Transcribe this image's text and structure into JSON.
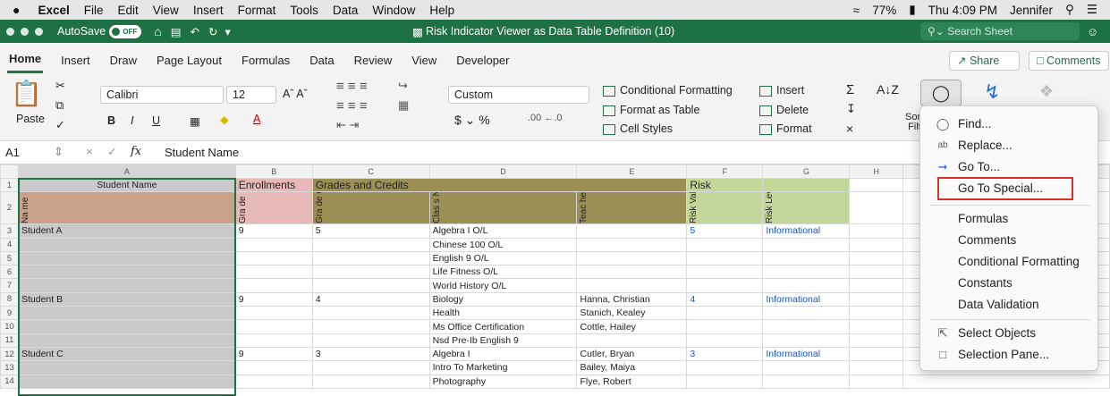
{
  "macbar": {
    "apple": "",
    "app": "Excel",
    "menus": [
      "File",
      "Edit",
      "View",
      "Insert",
      "Format",
      "Tools",
      "Data",
      "Window",
      "Help"
    ],
    "battery": "77%",
    "clock": "Thu 4:09 PM",
    "user": "Jennifer"
  },
  "titlebar": {
    "autosave": "AutoSave",
    "toggle": "OFF",
    "title": "Risk Indicator Viewer as Data Table Definition (10)",
    "search": "Search Sheet"
  },
  "tabs": [
    "Home",
    "Insert",
    "Draw",
    "Page Layout",
    "Formulas",
    "Data",
    "Review",
    "View",
    "Developer"
  ],
  "tab_buttons": {
    "share": "Share",
    "comments": "Comments"
  },
  "ribbon": {
    "paste": "Paste",
    "font": "Calibri",
    "size": "12",
    "number_format": "Custom",
    "cond_format": "Conditional Formatting",
    "format_table": "Format as Table",
    "cell_styles": "Cell Styles",
    "insert": "Insert",
    "delete": "Delete",
    "format": "Format",
    "sort": "Sort &",
    "filter": "Filter",
    "fx": "fx"
  },
  "formula_bar": {
    "cell": "A1",
    "content": "Student Name"
  },
  "columns": [
    "A",
    "B",
    "C",
    "D",
    "E",
    "F",
    "G",
    "H"
  ],
  "rows": [
    {
      "n": "1",
      "a": "Student Name",
      "b": "Enrollments",
      "c": "Grades and Credits",
      "d": "",
      "e": "",
      "f": "Risk",
      "g": ""
    },
    {
      "n": "2",
      "a": "Na me",
      "b": "Gra de",
      "c": "Gra de Cou nt",
      "d": "Clas s Na me",
      "e": "Teac her Na me",
      "f": "Risk Valu e",
      "g": "Risk Lev el"
    },
    {
      "n": "3",
      "a": "Student A",
      "b": "9",
      "c": "5",
      "d": "Algebra I O/L",
      "e": "",
      "f": "5",
      "g": "Informational"
    },
    {
      "n": "4",
      "a": "",
      "b": "",
      "c": "",
      "d": "Chinese 100 O/L",
      "e": "",
      "f": "",
      "g": ""
    },
    {
      "n": "5",
      "a": "",
      "b": "",
      "c": "",
      "d": "English 9 O/L",
      "e": "",
      "f": "",
      "g": ""
    },
    {
      "n": "6",
      "a": "",
      "b": "",
      "c": "",
      "d": "Life Fitness O/L",
      "e": "",
      "f": "",
      "g": ""
    },
    {
      "n": "7",
      "a": "",
      "b": "",
      "c": "",
      "d": "World History O/L",
      "e": "",
      "f": "",
      "g": ""
    },
    {
      "n": "8",
      "a": "Student B",
      "b": "9",
      "c": "4",
      "d": "Biology",
      "e": "Hanna, Christian",
      "f": "4",
      "g": "Informational"
    },
    {
      "n": "9",
      "a": "",
      "b": "",
      "c": "",
      "d": "Health",
      "e": "Stanich, Kealey",
      "f": "",
      "g": ""
    },
    {
      "n": "10",
      "a": "",
      "b": "",
      "c": "",
      "d": "Ms Office Certification",
      "e": "Cottle, Hailey",
      "f": "",
      "g": ""
    },
    {
      "n": "11",
      "a": "",
      "b": "",
      "c": "",
      "d": "Nsd Pre-Ib English 9",
      "e": "",
      "f": "",
      "g": ""
    },
    {
      "n": "12",
      "a": "Student C",
      "b": "9",
      "c": "3",
      "d": "Algebra I",
      "e": "Cutler, Bryan",
      "f": "3",
      "g": "Informational"
    },
    {
      "n": "13",
      "a": "",
      "b": "",
      "c": "",
      "d": "Intro To Marketing",
      "e": "Bailey, Maiya",
      "f": "",
      "g": ""
    },
    {
      "n": "14",
      "a": "",
      "b": "",
      "c": "",
      "d": "Photography",
      "e": "Flye, Robert",
      "f": "",
      "g": ""
    }
  ],
  "menu": {
    "find": "Find...",
    "replace": "Replace...",
    "goto": "Go To...",
    "goto_special": "Go To Special...",
    "formulas": "Formulas",
    "comments": "Comments",
    "cond": "Conditional Formatting",
    "constants": "Constants",
    "validation": "Data Validation",
    "select_objects": "Select Objects",
    "selection_pane": "Selection Pane..."
  },
  "colors": {
    "excel_green": "#1e7145",
    "enroll_fill": "#e6b8b7",
    "grades_fill": "#9c8f56",
    "risk_fill": "#c4d79b",
    "name_fill": "#c9a088",
    "highlight": "#d93025"
  }
}
